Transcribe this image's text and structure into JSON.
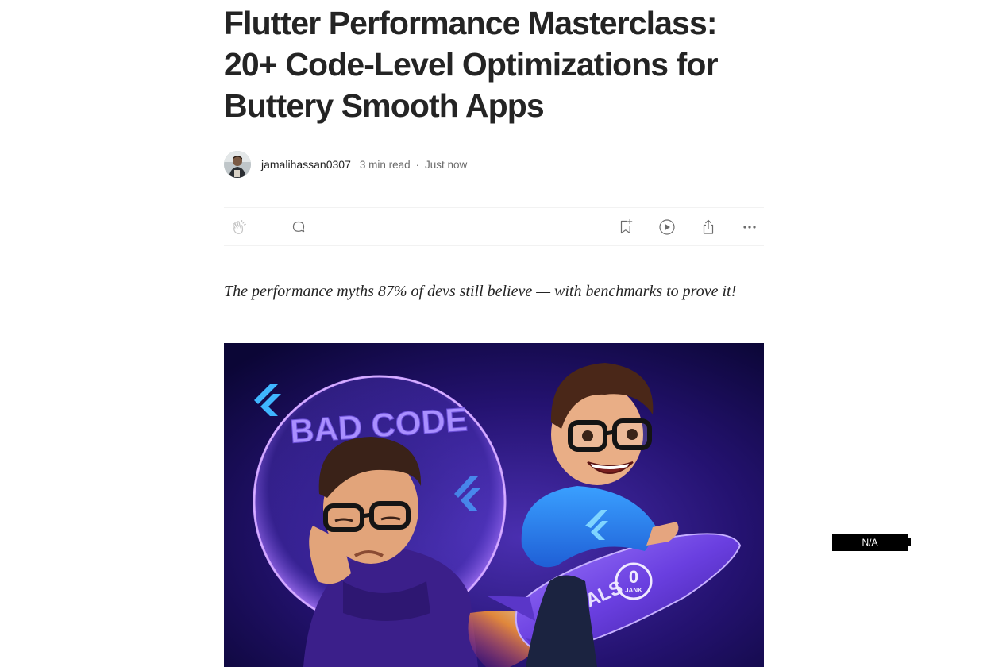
{
  "article": {
    "title": "Flutter Performance Masterclass:\n20+ Code-Level Optimizations for\nButtery Smooth Apps",
    "subtitle": "The performance myths 87% of devs still believe — with benchmarks to prove it!"
  },
  "byline": {
    "author": "jamalihassan0307",
    "read_time": "3 min read",
    "separator": "·",
    "published": "Just now"
  },
  "actions": {
    "clap_icon": "clap-icon",
    "comment_icon": "comment-icon",
    "bookmark_icon": "bookmark-add-icon",
    "listen_icon": "play-circle-icon",
    "share_icon": "share-icon",
    "more_icon": "more-horizontal-icon"
  },
  "hero_image": {
    "bubble_text": "BAD CODE",
    "rocket_text": "SIGNALS",
    "badge_number": "0",
    "badge_text": "JANK"
  },
  "widget": {
    "label": "N/A"
  }
}
